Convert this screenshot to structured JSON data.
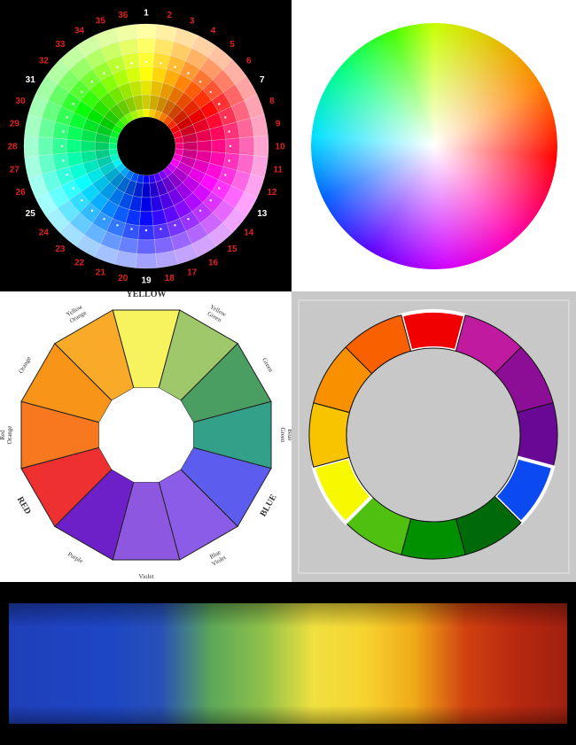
{
  "wheel36": {
    "numbers": [
      "1",
      "2",
      "3",
      "4",
      "5",
      "6",
      "7",
      "8",
      "9",
      "10",
      "11",
      "12",
      "13",
      "14",
      "15",
      "16",
      "17",
      "18",
      "19",
      "20",
      "21",
      "22",
      "23",
      "24",
      "25",
      "26",
      "27",
      "28",
      "29",
      "30",
      "31",
      "32",
      "33",
      "34",
      "35",
      "36"
    ],
    "highlight_indices": [
      1,
      7,
      13,
      19,
      25,
      31
    ],
    "highlight_color": "#ffffff",
    "number_color": "#e02020"
  },
  "wheel12": {
    "labels": [
      "YELLOW",
      "Yellow Green",
      "Green",
      "Blue Green",
      "BLUE",
      "Blue Violet",
      "Violet",
      "Purple",
      "RED",
      "Red Orange",
      "Orange",
      "Yellow Orange"
    ],
    "colors": [
      "#f7f35e",
      "#9fc86a",
      "#4a9e62",
      "#33a08a",
      "#5c5cee",
      "#8a5ce8",
      "#8d57e0",
      "#6e20c8",
      "#ee3030",
      "#f87820",
      "#f89418",
      "#f8aa28"
    ]
  },
  "ring12": {
    "colors": [
      "#f00000",
      "#c01aa0",
      "#8c0e96",
      "#6a0896",
      "#0a4af0",
      "#006a0a",
      "#009000",
      "#50c010",
      "#f8f800",
      "#f8c400",
      "#f89000",
      "#f86000"
    ],
    "outlined_indices": [
      0,
      4,
      8
    ]
  },
  "spectrum": {
    "bands": [
      "#1e3fb8",
      "#1f42c0",
      "#1d46c4",
      "#2850b8",
      "#5ca858",
      "#8ec04a",
      "#f0e040",
      "#f6d430",
      "#f0a818",
      "#d04010",
      "#b82810",
      "#a02010"
    ]
  }
}
